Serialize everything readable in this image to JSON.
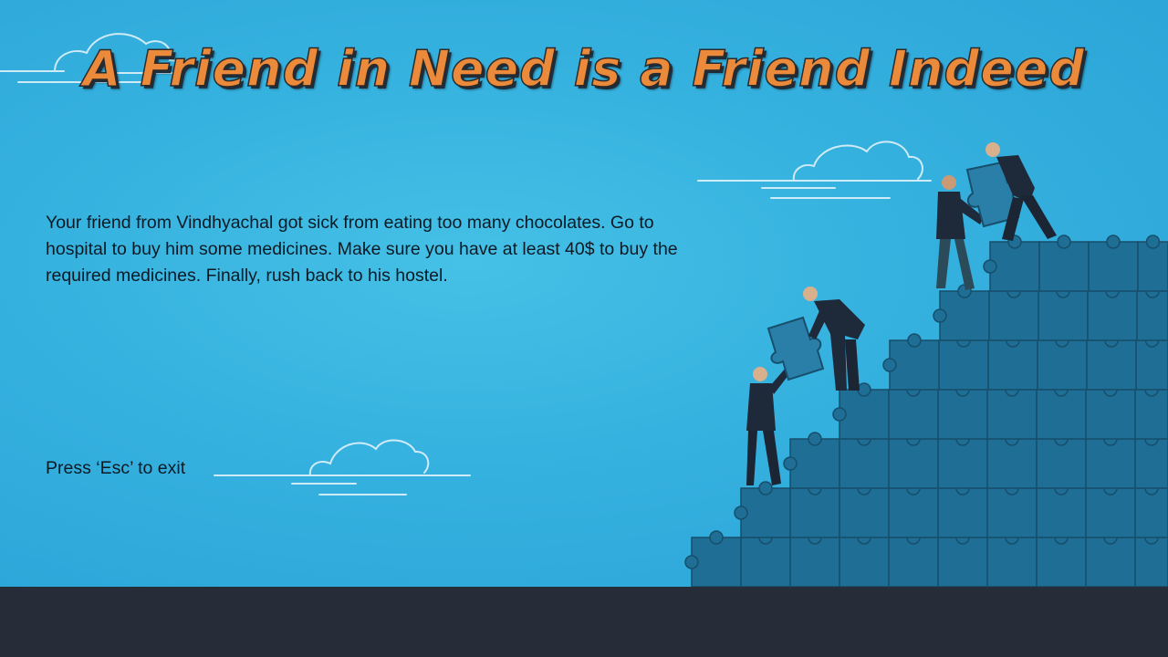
{
  "title": "A Friend in Need is a Friend Indeed",
  "story": {
    "text": "Your friend from Vindhyachal got sick from eating too many chocolates. Go to hospital to buy him some medicines. Make sure you have at least 40$ to buy the required medicines. Finally, rush back to his hostel."
  },
  "exit_hint": "Press ‘Esc’ to exit",
  "colors": {
    "sky": "#35b1df",
    "ground": "#272d38",
    "title_fill": "#ec8a3c",
    "puzzle": "#1f6e95",
    "puzzle_line": "#174f6c",
    "cloud_outline": "#e9f6fc"
  },
  "illustration": {
    "name": "puzzle-pyramid-teamwork",
    "figures": [
      "businessman-bottom",
      "businessman-middle",
      "businessman-lower-top",
      "businessman-upper-top"
    ]
  }
}
